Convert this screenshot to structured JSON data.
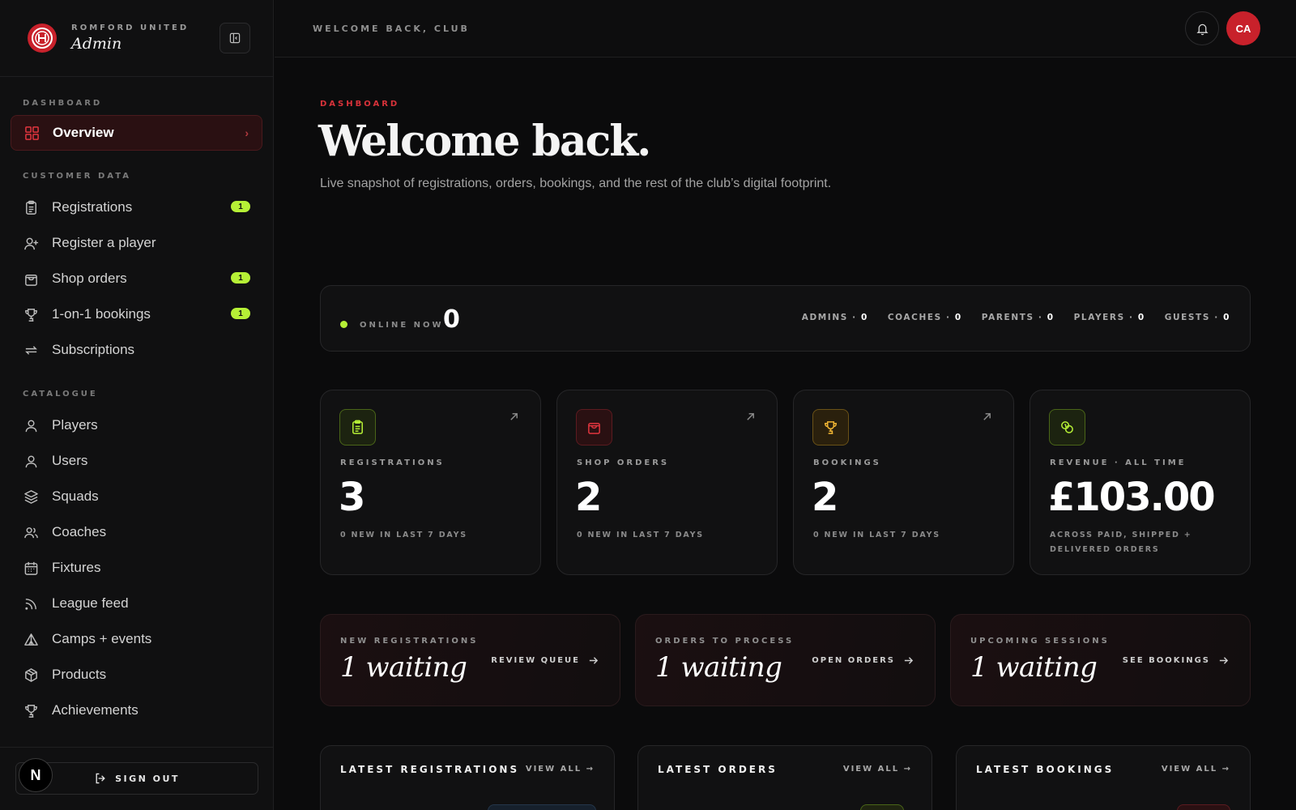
{
  "brand": {
    "club": "ROMFORD UNITED",
    "title": "Admin"
  },
  "sidebar": {
    "sections": {
      "dashboard": "DASHBOARD",
      "customer_data": "CUSTOMER DATA",
      "catalogue": "CATALOGUE"
    },
    "items": [
      {
        "label": "Overview",
        "icon": "grid-icon",
        "active": true
      },
      {
        "label": "Registrations",
        "icon": "clipboard-icon",
        "badge": "1"
      },
      {
        "label": "Register a player",
        "icon": "user-plus-icon"
      },
      {
        "label": "Shop orders",
        "icon": "shopping-bag-icon",
        "badge": "1"
      },
      {
        "label": "1-on-1 bookings",
        "icon": "trophy-icon",
        "badge": "1"
      },
      {
        "label": "Subscriptions",
        "icon": "repeat-icon"
      },
      {
        "label": "Players",
        "icon": "user-icon"
      },
      {
        "label": "Users",
        "icon": "user-icon"
      },
      {
        "label": "Squads",
        "icon": "layers-icon"
      },
      {
        "label": "Coaches",
        "icon": "users-icon"
      },
      {
        "label": "Fixtures",
        "icon": "calendar-icon"
      },
      {
        "label": "League feed",
        "icon": "rss-icon"
      },
      {
        "label": "Camps + events",
        "icon": "tent-icon"
      },
      {
        "label": "Products",
        "icon": "package-icon"
      },
      {
        "label": "Achievements",
        "icon": "trophy-icon"
      }
    ],
    "sign_out": "SIGN OUT",
    "n_badge": "N"
  },
  "topbar": {
    "title": "WELCOME BACK, CLUB",
    "avatar": "CA"
  },
  "header": {
    "kicker": "DASHBOARD",
    "title": "Welcome back.",
    "subtitle": "Live snapshot of registrations, orders, bookings, and the rest of the club’s digital footprint."
  },
  "online": {
    "label": "ONLINE NOW",
    "count": "0",
    "roles": [
      {
        "label": "ADMINS · ",
        "count": "0"
      },
      {
        "label": "COACHES · ",
        "count": "0"
      },
      {
        "label": "PARENTS · ",
        "count": "0"
      },
      {
        "label": "PLAYERS · ",
        "count": "0"
      },
      {
        "label": "GUESTS · ",
        "count": "0"
      }
    ]
  },
  "stats": [
    {
      "label": "REGISTRATIONS",
      "value": "3",
      "sub": "0 NEW IN LAST 7 DAYS",
      "icon": "clipboard-icon",
      "color": "#b6f036"
    },
    {
      "label": "SHOP ORDERS",
      "value": "2",
      "sub": "0 NEW IN LAST 7 DAYS",
      "icon": "shopping-bag-icon",
      "color": "#e0353e"
    },
    {
      "label": "BOOKINGS",
      "value": "2",
      "sub": "0 NEW IN LAST 7 DAYS",
      "icon": "trophy-icon",
      "color": "#f0b533"
    },
    {
      "label": "REVENUE · ALL TIME",
      "value": "£103.00",
      "sub": "ACROSS PAID, SHIPPED + DELIVERED ORDERS",
      "icon": "coins-icon",
      "color": "#b6f036"
    }
  ],
  "actions": [
    {
      "label": "NEW REGISTRATIONS",
      "value": "1 waiting",
      "link": "REVIEW QUEUE"
    },
    {
      "label": "ORDERS TO PROCESS",
      "value": "1 waiting",
      "link": "OPEN ORDERS"
    },
    {
      "label": "UPCOMING SESSIONS",
      "value": "1 waiting",
      "link": "SEE BOOKINGS"
    }
  ],
  "lists": [
    {
      "title": "LATEST REGISTRATIONS",
      "view_all": "VIEW ALL →"
    },
    {
      "title": "LATEST ORDERS",
      "view_all": "VIEW ALL →"
    },
    {
      "title": "LATEST BOOKINGS",
      "view_all": "VIEW ALL →"
    }
  ],
  "colors": {
    "accent": "#c8212b",
    "lime": "#b6f036",
    "gold": "#f0b533",
    "background": "#0b0b0c"
  }
}
